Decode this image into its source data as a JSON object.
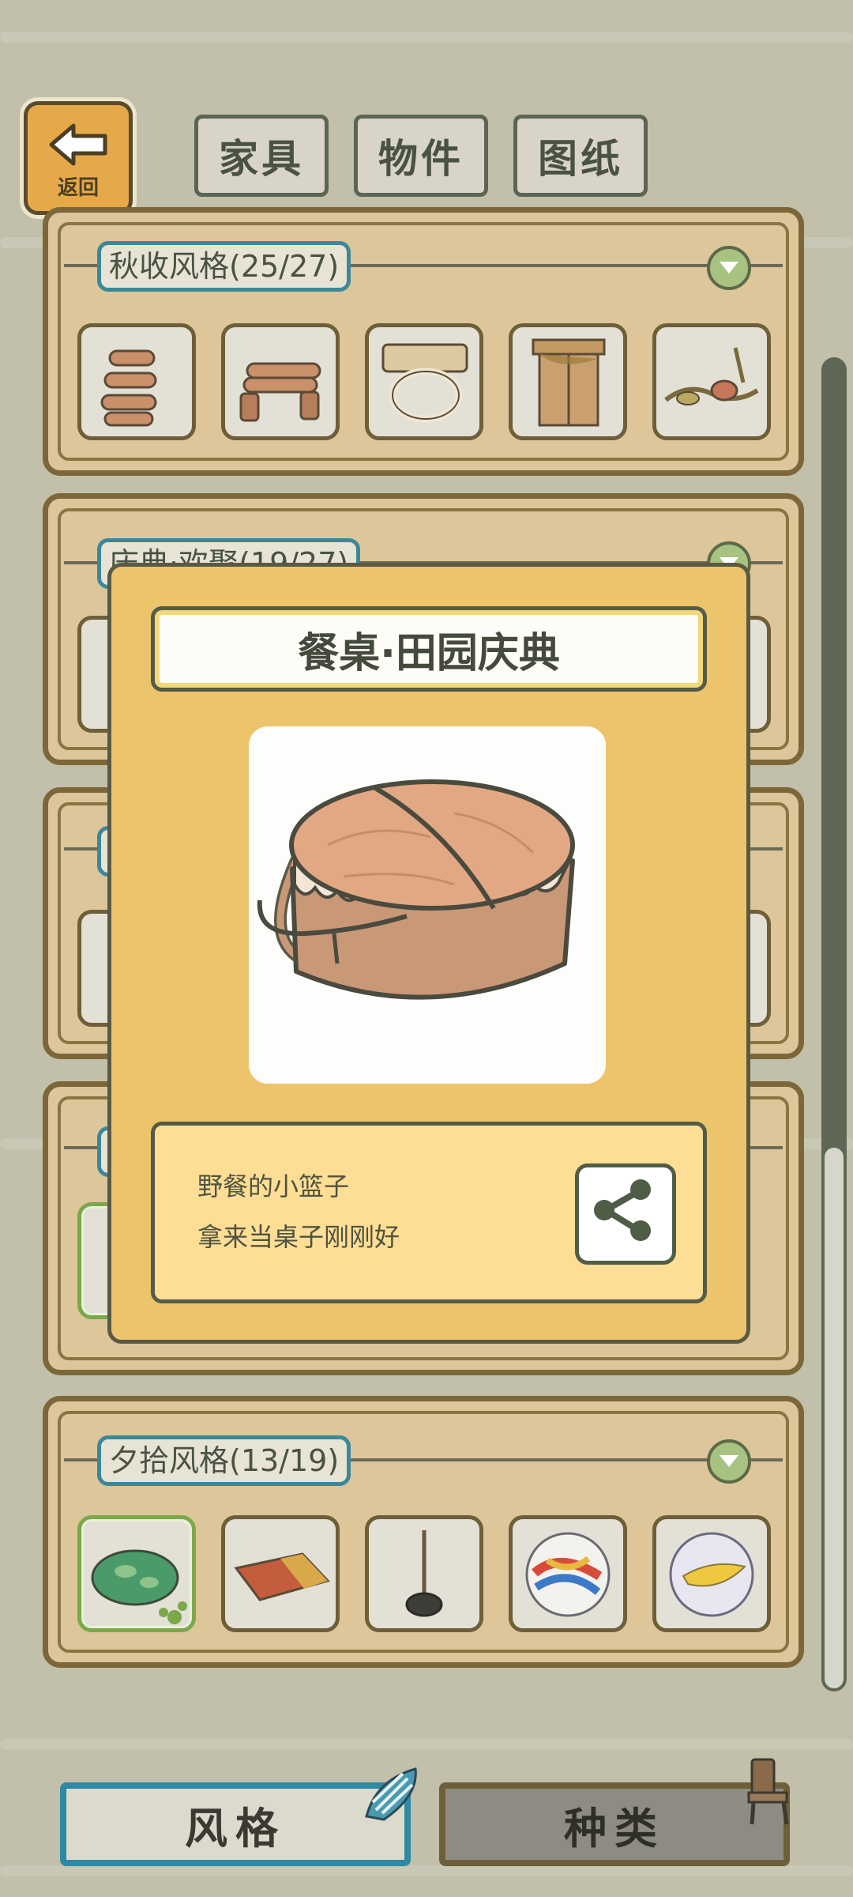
{
  "nav": {
    "back_label": "返回",
    "tabs": [
      "家具",
      "物件",
      "图纸"
    ]
  },
  "categories": [
    {
      "label": "秋收风格(25/27)"
    },
    {
      "label": "庆典·欢聚(19/27)"
    },
    {
      "label": "夕拾风格(13/19)"
    }
  ],
  "modal": {
    "title": "餐桌·田园庆典",
    "desc_line1": "野餐的小篮子",
    "desc_line2": "拿来当桌子刚刚好"
  },
  "bottom_tabs": [
    "风格",
    "种类"
  ],
  "colors": {
    "background": "#c2bfaa",
    "panel": "#dcc69a",
    "modal": "#ecc46c",
    "accent_teal": "#2c8aa3",
    "selected_green": "#7aa84a"
  }
}
